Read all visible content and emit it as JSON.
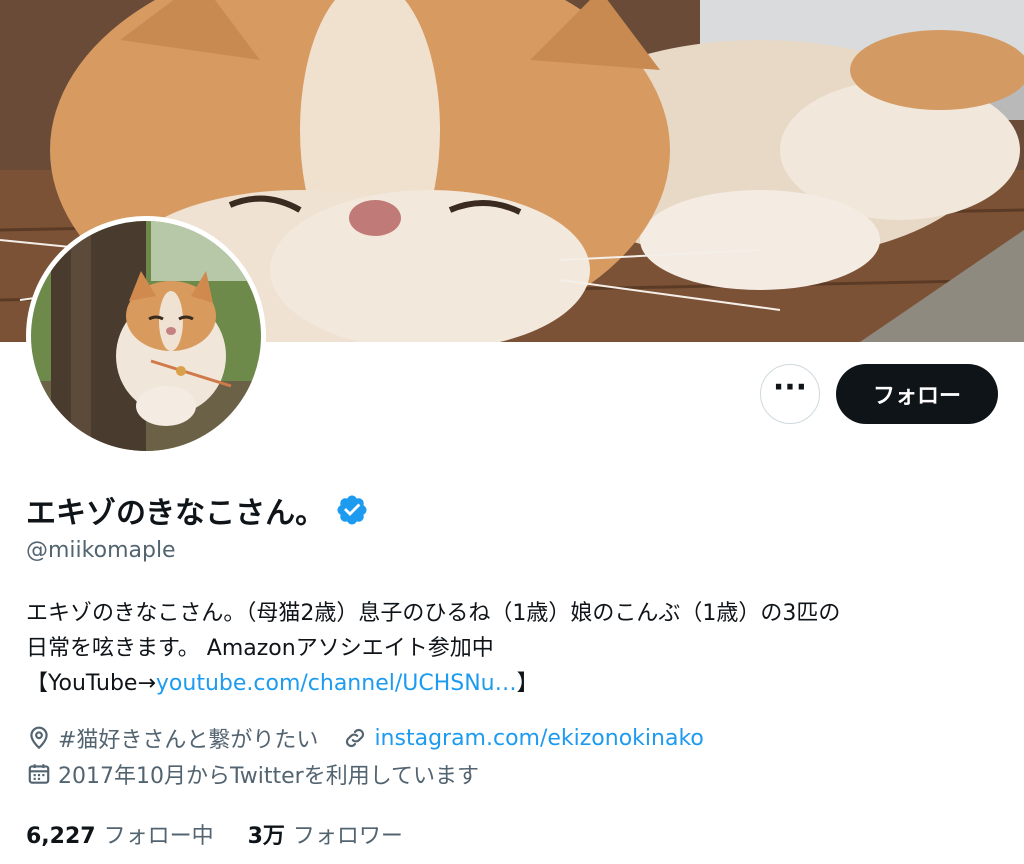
{
  "profile": {
    "display_name": "エキゾのきなこさん。",
    "handle": "@miikomaple",
    "verified": true,
    "bio": {
      "line1": "エキゾのきなこさん。（母猫2歳）息子のひるね（1歳）娘のこんぶ（1歳）の3匹の",
      "line2": "日常を呟きます。 Amazonアソシエイト参加中",
      "line3_prefix": "【YouTube→",
      "line3_link": "youtube.com/channel/UCHSNu…",
      "line3_suffix": "】"
    },
    "location": "#猫好きさんと繋がりたい",
    "website": "instagram.com/ekizonokinako",
    "joined": "2017年10月からTwitterを利用しています"
  },
  "actions": {
    "more_label": "···",
    "follow_label": "フォロー"
  },
  "stats": {
    "following_count": "6,227",
    "following_label": "フォロー中",
    "followers_count": "3万",
    "followers_label": "フォロワー"
  },
  "icons": {
    "verified": "verified-badge-icon",
    "location": "location-pin-icon",
    "link": "link-icon",
    "calendar": "calendar-icon",
    "more": "more-icon"
  },
  "colors": {
    "accent": "#1d9bf0",
    "text_primary": "#0f1419",
    "text_secondary": "#536471",
    "follow_button_bg": "#0f1419"
  }
}
